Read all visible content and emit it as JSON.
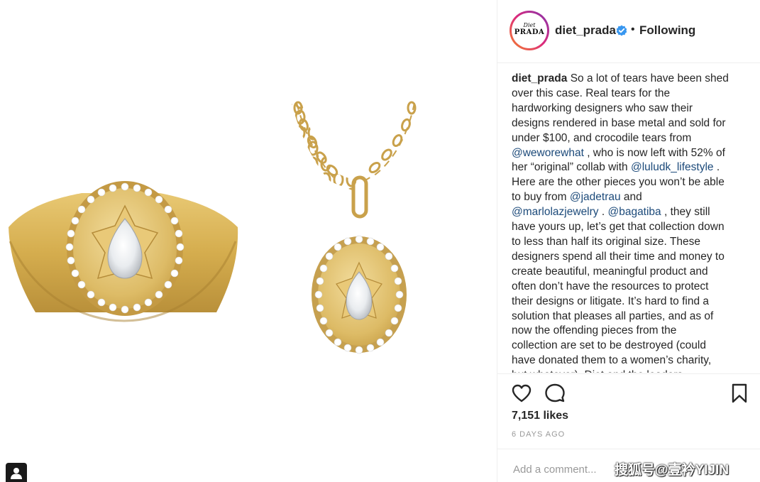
{
  "post": {
    "username": "diet_prada",
    "avatar_text_top": "Diet",
    "avatar_text_bottom": "PRADA",
    "separator": "•",
    "follow_status": "Following",
    "verified_icon": "verified-badge-icon",
    "caption_lines": [
      [
        {
          "t": "diet_prada",
          "s": "b"
        },
        {
          "t": " So a lot of tears have been shed"
        }
      ],
      [
        {
          "t": "over this case.  Real tears for the"
        }
      ],
      [
        {
          "t": "hardworking designers who saw their"
        }
      ],
      [
        {
          "t": "designs rendered in base metal and sold for"
        }
      ],
      [
        {
          "t": "under $100, and crocodile tears from"
        }
      ],
      [
        {
          "t": "@weworewhat",
          "s": "m"
        },
        {
          "t": " , who is now left with 52% of"
        }
      ],
      [
        {
          "t": "her “original” collab with "
        },
        {
          "t": "@luludk_lifestyle",
          "s": "m"
        },
        {
          "t": " ."
        }
      ],
      [
        {
          "t": "Here are the other pieces you won’t be able"
        }
      ],
      [
        {
          "t": "to buy from "
        },
        {
          "t": "@jadetrau",
          "s": "m"
        },
        {
          "t": " and"
        }
      ],
      [
        {
          "t": "@marlolazjewelry",
          "s": "m"
        },
        {
          "t": " . "
        },
        {
          "t": "@bagatiba",
          "s": "m"
        },
        {
          "t": " , they still"
        }
      ],
      [
        {
          "t": "have yours up, let’s get that collection down"
        }
      ],
      [
        {
          "t": "to less than half its original size. These"
        }
      ],
      [
        {
          "t": "designers spend all their time and money to"
        }
      ],
      [
        {
          "t": "create beautiful, meaningful product and"
        }
      ],
      [
        {
          "t": "often don’t have the resources to protect"
        }
      ],
      [
        {
          "t": "their designs or litigate. It’s hard to find a"
        }
      ],
      [
        {
          "t": "solution that pleases all parties, and as of"
        }
      ],
      [
        {
          "t": "now the offending pieces from the"
        }
      ],
      [
        {
          "t": "collection are set to be destroyed (could"
        }
      ],
      [
        {
          "t": "have donated them to a women’s charity,"
        }
      ],
      [
        {
          "t": "but whatever). Diet and the leaders"
        }
      ]
    ],
    "likes": "7,151 likes",
    "time_ago": "6 DAYS AGO",
    "comment_placeholder": "Add a comment...",
    "icons": [
      "heart-icon",
      "comment-icon",
      "bookmark-icon",
      "user-tag-icon"
    ]
  },
  "watermark": "搜狐号@壹衿YIJIN"
}
